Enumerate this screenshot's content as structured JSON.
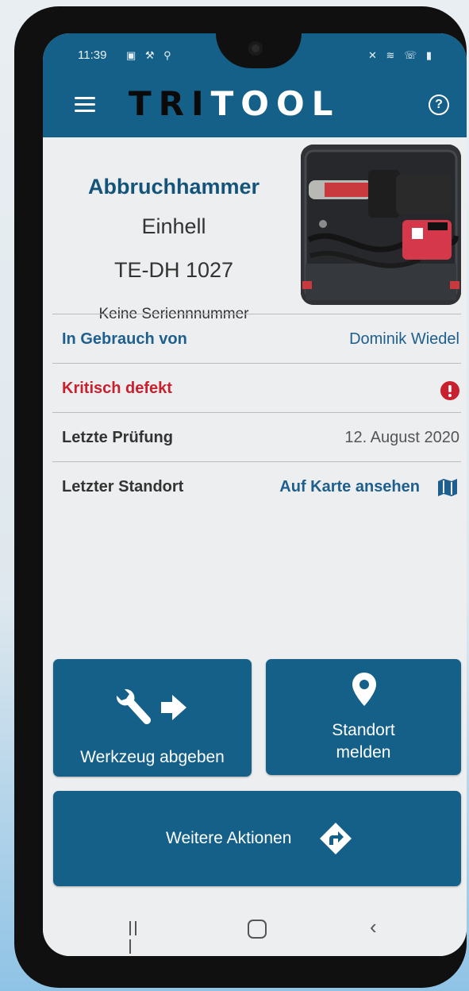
{
  "status_bar": {
    "time": "11:39",
    "left_icons": "▣ ⚒ ⚲",
    "right_icons": "✕ ≋ ☏ ▮"
  },
  "header": {
    "brand_dark": "TRI",
    "brand_light": "TOOL",
    "help_icon": "?"
  },
  "tool": {
    "name": "Abbruchhammer",
    "brand": "Einhell",
    "model": "TE-DH 1027",
    "serial": "Keine Seriennnummer"
  },
  "details": {
    "in_use_label": "In Gebrauch von",
    "in_use_value": "Dominik Wiedel",
    "defect_label": "Kritisch defekt",
    "last_check_label": "Letzte Prüfung",
    "last_check_value": "12. August 2020",
    "last_location_label": "Letzter Standort",
    "last_location_link": "Auf Karte ansehen"
  },
  "actions": {
    "hand_over": "Werkzeug abgeben",
    "report_location_line1": "Standort",
    "report_location_line2": "melden",
    "more_actions": "Weitere Aktionen"
  },
  "colors": {
    "primary": "#146089",
    "title_blue": "#15547a",
    "link_blue": "#1f5f8d",
    "danger": "#c8202e"
  },
  "icons": {
    "menu": "menu-icon",
    "help": "help-icon",
    "defect": "exclamation-circle-icon",
    "map": "map-icon",
    "wrench": "wrench-icon",
    "arrow_right": "arrow-right-icon",
    "location_pin": "location-pin-icon",
    "turn_right": "turn-right-sign-icon"
  }
}
